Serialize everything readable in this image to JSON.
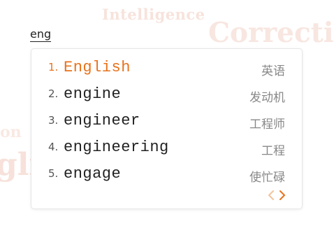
{
  "watermarks": {
    "intelligence": "Intelligence",
    "correction": "Correcti",
    "on": "on",
    "glis": "glis"
  },
  "input": {
    "typed_text": "eng"
  },
  "candidates": [
    {
      "index": "1.",
      "word": "English",
      "translation": "英语",
      "active": true
    },
    {
      "index": "2.",
      "word": "engine",
      "translation": "发动机",
      "active": false
    },
    {
      "index": "3.",
      "word": "engineer",
      "translation": "工程师",
      "active": false
    },
    {
      "index": "4.",
      "word": "engineering",
      "translation": "工程",
      "active": false
    },
    {
      "index": "5.",
      "word": "engage",
      "translation": "使忙碌",
      "active": false
    }
  ],
  "colors": {
    "accent": "#e8721c",
    "accent_disabled": "#f3c39c",
    "word": "#222222",
    "translation": "#888888"
  },
  "pager": {
    "prev_icon": "chevron-left-icon",
    "next_icon": "chevron-right-icon"
  }
}
